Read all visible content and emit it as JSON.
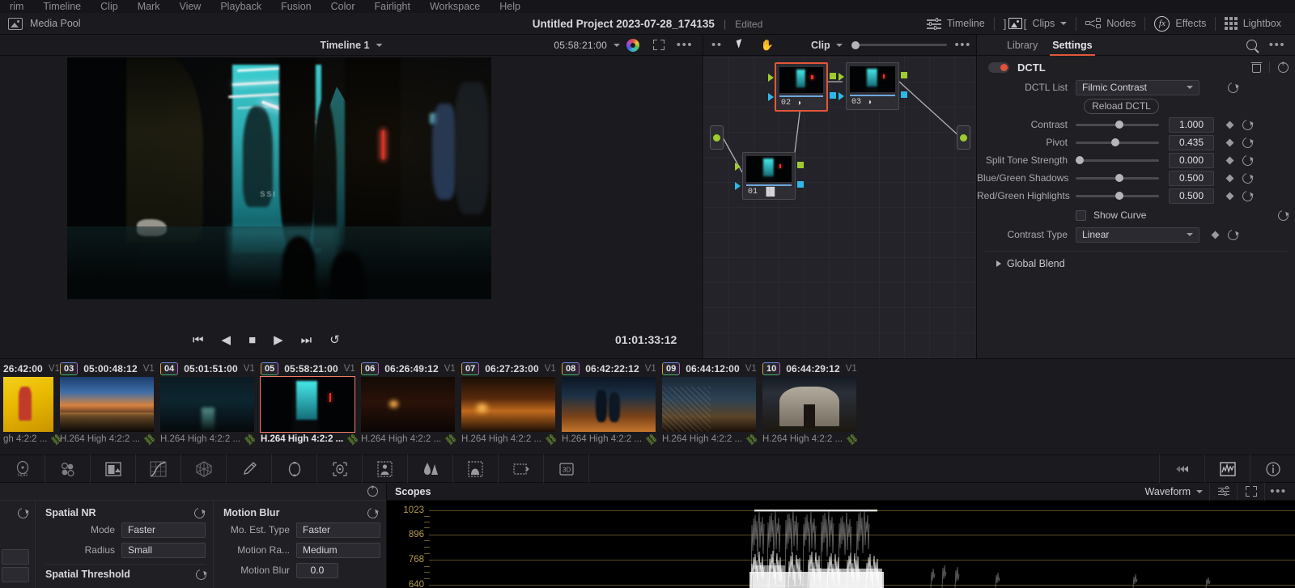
{
  "menubar": {
    "items": [
      "rim",
      "Timeline",
      "Clip",
      "Mark",
      "View",
      "Playback",
      "Fusion",
      "Color",
      "Fairlight",
      "Workspace",
      "Help"
    ]
  },
  "topbar": {
    "media_pool_label": "Media Pool",
    "project_title": "Untitled Project 2023-07-28_174135",
    "separator": "|",
    "edited_status": "Edited",
    "right_items": [
      {
        "label": "Timeline",
        "icon": "timeline-icon",
        "has_chevron": false
      },
      {
        "label": "Clips",
        "icon": "clips-icon",
        "has_chevron": true
      },
      {
        "label": "Nodes",
        "icon": "nodes-icon",
        "has_chevron": false
      },
      {
        "label": "Effects",
        "icon": "fx-icon",
        "has_chevron": false
      },
      {
        "label": "Lightbox",
        "icon": "lightbox-icon",
        "has_chevron": false
      }
    ]
  },
  "viewer": {
    "timeline_name": "Timeline 1",
    "timecode": "05:58:21:00",
    "playhead_timecode": "01:01:33:12",
    "transport": [
      {
        "name": "jump-to-start-button",
        "glyph": "⏮"
      },
      {
        "name": "reverse-play-button",
        "glyph": "◀"
      },
      {
        "name": "stop-button",
        "glyph": "■"
      },
      {
        "name": "play-button",
        "glyph": "▶"
      },
      {
        "name": "jump-to-end-button",
        "glyph": "⏭"
      },
      {
        "name": "loop-button",
        "glyph": "↺"
      }
    ]
  },
  "node_graph": {
    "mode_label": "Clip",
    "nodes": [
      {
        "num": "01",
        "icon_glyph": "▐█",
        "selected": false
      },
      {
        "num": "02",
        "icon_glyph": "◑",
        "selected": true
      },
      {
        "num": "03",
        "icon_glyph": "◑",
        "selected": false
      }
    ]
  },
  "right_panel": {
    "tabs": [
      {
        "label": "Library",
        "active": false
      },
      {
        "label": "Settings",
        "active": true
      }
    ],
    "effect_name": "DCTL",
    "enabled": true,
    "fields": [
      {
        "label": "DCTL List",
        "type": "dropdown",
        "value": "Filmic Contrast",
        "keyframe": false
      },
      {
        "label": "",
        "type": "button",
        "value": "Reload DCTL",
        "keyframe": false
      },
      {
        "label": "Contrast",
        "type": "slider",
        "value": "1.000",
        "pct": 48,
        "keyframe": true
      },
      {
        "label": "Pivot",
        "type": "slider",
        "value": "0.435",
        "pct": 43,
        "keyframe": true
      },
      {
        "label": "Split Tone Strength",
        "type": "slider",
        "value": "0.000",
        "pct": 0,
        "keyframe": true
      },
      {
        "label": "Blue/Green Shadows",
        "type": "slider",
        "value": "0.500",
        "pct": 48,
        "keyframe": true
      },
      {
        "label": "Red/Green Highlights",
        "type": "slider",
        "value": "0.500",
        "pct": 48,
        "keyframe": true
      },
      {
        "label": "",
        "type": "checkbox",
        "value": "Show Curve",
        "checked": false,
        "keyframe": false
      },
      {
        "label": "Contrast Type",
        "type": "dropdown",
        "value": "Linear",
        "keyframe": true
      }
    ],
    "global_blend_label": "Global Blend",
    "accent_color": "#e4563a"
  },
  "filmstrip": {
    "clips": [
      {
        "badge": "",
        "timecode": "26:42:00",
        "track": "V1",
        "codec": "gh 4:2:2 ...",
        "selected": false,
        "scene": "th-yellow",
        "partial": true
      },
      {
        "badge": "03",
        "timecode": "05:00:48:12",
        "track": "V1",
        "codec": "H.264 High 4:2:2 ...",
        "selected": false,
        "scene": "th-dusk"
      },
      {
        "badge": "04",
        "timecode": "05:01:51:00",
        "track": "V1",
        "codec": "H.264 High 4:2:2 ...",
        "selected": false,
        "scene": "th-road"
      },
      {
        "badge": "05",
        "timecode": "05:58:21:00",
        "track": "V1",
        "codec": "H.264 High 4:2:2 ...",
        "selected": true,
        "scene": "th-alley"
      },
      {
        "badge": "06",
        "timecode": "06:26:49:12",
        "track": "V1",
        "codec": "H.264 High 4:2:2 ...",
        "selected": false,
        "scene": "th-night"
      },
      {
        "badge": "07",
        "timecode": "06:27:23:00",
        "track": "V1",
        "codec": "H.264 High 4:2:2 ...",
        "selected": false,
        "scene": "th-street"
      },
      {
        "badge": "08",
        "timecode": "06:42:22:12",
        "track": "V1",
        "codec": "H.264 High 4:2:2 ...",
        "selected": false,
        "scene": "th-people"
      },
      {
        "badge": "09",
        "timecode": "06:44:12:00",
        "track": "V1",
        "codec": "H.264 High 4:2:2 ...",
        "selected": false,
        "scene": "th-fence"
      },
      {
        "badge": "10",
        "timecode": "06:44:29:12",
        "track": "V1",
        "codec": "H.264 High 4:2:2 ...",
        "selected": false,
        "scene": "th-church"
      }
    ]
  },
  "color_toolbar": {
    "left_icons": [
      "hdr-wheels-icon",
      "primaries-bars-icon",
      "rgb-mixer-icon",
      "curves-icon",
      "color-warper-icon",
      "qualifier-eyedropper-icon",
      "power-window-icon",
      "tracker-icon",
      "magic-mask-icon",
      "blur-icon",
      "key-icon",
      "sizing-icon",
      "3d-keyer-icon"
    ],
    "right_icons": [
      "stills-icon",
      "scopes-icon",
      "info-icon"
    ]
  },
  "motion_effects": {
    "spatial_nr": {
      "title": "Spatial NR",
      "rows": [
        {
          "label": "Mode",
          "value": "Faster",
          "type": "dropdown"
        },
        {
          "label": "Radius",
          "value": "Small",
          "type": "dropdown"
        }
      ],
      "sub_title": "Spatial Threshold"
    },
    "motion_blur": {
      "title": "Motion Blur",
      "rows": [
        {
          "label": "Mo. Est. Type",
          "value": "Faster",
          "type": "dropdown"
        },
        {
          "label": "Motion Ra...",
          "value": "Medium",
          "type": "dropdown"
        },
        {
          "label": "Motion Blur",
          "value": "0.0",
          "type": "number"
        }
      ]
    }
  },
  "scopes": {
    "title": "Scopes",
    "selected_scope": "Waveform",
    "chart_data": {
      "type": "line",
      "title": "Waveform",
      "ylabel": "",
      "xlabel": "",
      "ytick_labels": [
        "1023",
        "896",
        "768",
        "640"
      ],
      "ytick_values": [
        1023,
        896,
        768,
        640
      ],
      "ylim": [
        640,
        1023
      ],
      "grid": true,
      "grid_color": "#6b5a2c",
      "label_color": "#b49a4e",
      "trace_color": "#ffffff",
      "background": "#000000"
    }
  }
}
